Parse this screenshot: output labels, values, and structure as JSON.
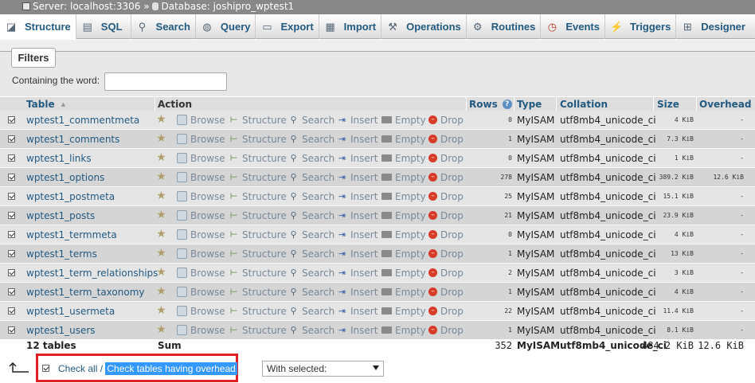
{
  "breadcrumb": {
    "server_label": "Server: localhost:3306",
    "separator": "»",
    "database_label": "Database: joshipro_wptest1"
  },
  "tabs": [
    {
      "label": "Structure",
      "icon": "structure-icon",
      "active": true
    },
    {
      "label": "SQL",
      "icon": "sql-icon",
      "active": false
    },
    {
      "label": "Search",
      "icon": "search-icon",
      "active": false
    },
    {
      "label": "Query",
      "icon": "query-icon",
      "active": false
    },
    {
      "label": "Export",
      "icon": "export-icon",
      "active": false
    },
    {
      "label": "Import",
      "icon": "import-icon",
      "active": false
    },
    {
      "label": "Operations",
      "icon": "wrench-icon",
      "active": false
    },
    {
      "label": "Routines",
      "icon": "routines-icon",
      "active": false
    },
    {
      "label": "Events",
      "icon": "clock-icon",
      "active": false
    },
    {
      "label": "Triggers",
      "icon": "triggers-icon",
      "active": false
    },
    {
      "label": "Designer",
      "icon": "designer-icon",
      "active": false
    }
  ],
  "filters": {
    "legend": "Filters",
    "contains_label": "Containing the word:",
    "contains_value": ""
  },
  "table_headers": {
    "table": "Table",
    "sort_indicator": "▲",
    "action": "Action",
    "rows": "Rows",
    "type": "Type",
    "collation": "Collation",
    "size": "Size",
    "overhead": "Overhead"
  },
  "actions": {
    "browse": "Browse",
    "structure": "Structure",
    "search": "Search",
    "insert": "Insert",
    "empty": "Empty",
    "drop": "Drop"
  },
  "tables": [
    {
      "name": "wptest1_commentmeta",
      "rows": "0",
      "type": "MyISAM",
      "collation": "utf8mb4_unicode_ci",
      "size": "4 KiB",
      "overhead": "-"
    },
    {
      "name": "wptest1_comments",
      "rows": "1",
      "type": "MyISAM",
      "collation": "utf8mb4_unicode_ci",
      "size": "7.3 KiB",
      "overhead": "-"
    },
    {
      "name": "wptest1_links",
      "rows": "0",
      "type": "MyISAM",
      "collation": "utf8mb4_unicode_ci",
      "size": "1 KiB",
      "overhead": "-"
    },
    {
      "name": "wptest1_options",
      "rows": "278",
      "type": "MyISAM",
      "collation": "utf8mb4_unicode_ci",
      "size": "389.2 KiB",
      "overhead": "12.6 KiB"
    },
    {
      "name": "wptest1_postmeta",
      "rows": "25",
      "type": "MyISAM",
      "collation": "utf8mb4_unicode_ci",
      "size": "15.1 KiB",
      "overhead": "-"
    },
    {
      "name": "wptest1_posts",
      "rows": "21",
      "type": "MyISAM",
      "collation": "utf8mb4_unicode_ci",
      "size": "23.9 KiB",
      "overhead": "-"
    },
    {
      "name": "wptest1_termmeta",
      "rows": "0",
      "type": "MyISAM",
      "collation": "utf8mb4_unicode_ci",
      "size": "4 KiB",
      "overhead": "-"
    },
    {
      "name": "wptest1_terms",
      "rows": "1",
      "type": "MyISAM",
      "collation": "utf8mb4_unicode_ci",
      "size": "13 KiB",
      "overhead": "-"
    },
    {
      "name": "wptest1_term_relationships",
      "rows": "2",
      "type": "MyISAM",
      "collation": "utf8mb4_unicode_ci",
      "size": "3 KiB",
      "overhead": "-"
    },
    {
      "name": "wptest1_term_taxonomy",
      "rows": "1",
      "type": "MyISAM",
      "collation": "utf8mb4_unicode_ci",
      "size": "4 KiB",
      "overhead": "-"
    },
    {
      "name": "wptest1_usermeta",
      "rows": "22",
      "type": "MyISAM",
      "collation": "utf8mb4_unicode_ci",
      "size": "11.4 KiB",
      "overhead": "-"
    },
    {
      "name": "wptest1_users",
      "rows": "1",
      "type": "MyISAM",
      "collation": "utf8mb4_unicode_ci",
      "size": "8.1 KiB",
      "overhead": "-"
    }
  ],
  "summary": {
    "count": "12 tables",
    "label": "Sum",
    "rows": "352",
    "type": "MyISAM",
    "collation": "utf8mb4_unicode_ci",
    "size": "484.2 KiB",
    "overhead": "12.6 KiB"
  },
  "footer": {
    "check_all": "Check all",
    "slash": "/",
    "check_overhead": "Check tables having overhead",
    "with_selected": "With selected:"
  },
  "colors": {
    "link": "#235a81",
    "highlight": "#3399ff",
    "annotation_box": "#e02020"
  }
}
